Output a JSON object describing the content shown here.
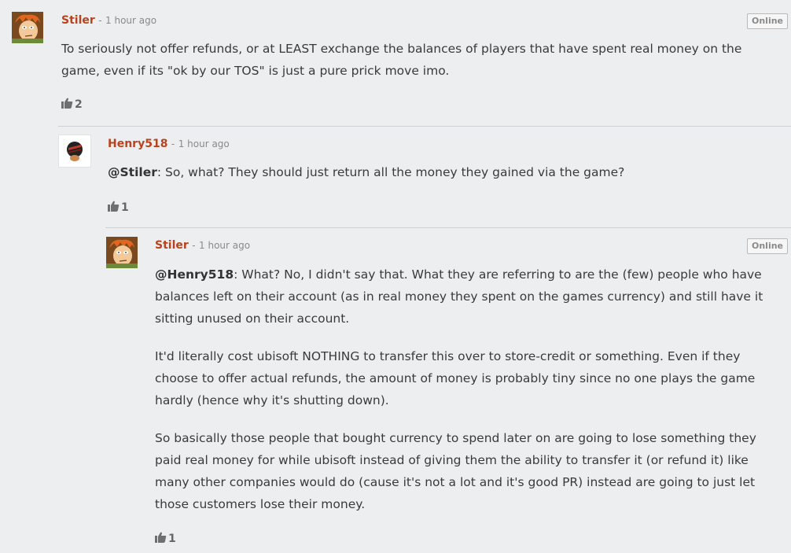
{
  "comments": [
    {
      "author": "Stiler",
      "separator": "-",
      "time": "1 hour ago",
      "badge": "Online",
      "paragraphs": [
        "To seriously not offer refunds, or at LEAST exchange the balances of players that have spent real money on the game, even if its \"ok by our TOS\" is just a pure prick move imo."
      ],
      "likes": "2",
      "avatar_icon": "fry-avatar-icon"
    },
    {
      "author": "Henry518",
      "separator": "-",
      "time": "1 hour ago",
      "mention": "@Stiler",
      "paragraphs": [
        ": So, what? They should just return all the money they gained via the game?"
      ],
      "likes": "1",
      "avatar_icon": "masked-figure-avatar-icon"
    },
    {
      "author": "Stiler",
      "separator": "-",
      "time": "1 hour ago",
      "badge": "Online",
      "mention": "@Henry518",
      "paragraphs": [
        ": What? No, I didn't say that. What they are referring to are the (few) people who have balances left on their account (as in real money they spent on the games currency) and still have it sitting unused on their account.",
        "It'd literally cost ubisoft NOTHING to transfer this over to store-credit or something. Even if they choose to offer actual refunds, the amount of money is probably tiny since no one plays the game hardly (hence why it's shutting down).",
        "So basically those people that bought currency to spend later on are going to lose something they paid real money for while ubisoft instead of giving them the ability to transfer it (or refund it) like many other companies would do (cause it's not a lot and it's good PR) instead are going to just let those customers lose their money."
      ],
      "likes": "1",
      "avatar_icon": "fry-avatar-icon"
    }
  ],
  "colors": {
    "author": "#b8431e",
    "background": "#edeef0",
    "text": "#3a3a3a",
    "meta": "#8a8a8a"
  }
}
